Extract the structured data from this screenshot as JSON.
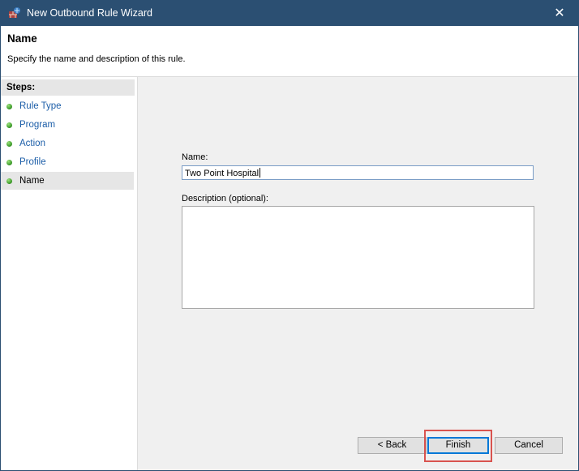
{
  "window": {
    "title": "New Outbound Rule Wizard",
    "close_glyph": "✕",
    "icon": "firewall-icon"
  },
  "header": {
    "title": "Name",
    "subtitle": "Specify the name and description of this rule."
  },
  "steps": {
    "heading": "Steps:",
    "items": [
      {
        "label": "Rule Type",
        "state": "completed"
      },
      {
        "label": "Program",
        "state": "completed"
      },
      {
        "label": "Action",
        "state": "completed"
      },
      {
        "label": "Profile",
        "state": "completed"
      },
      {
        "label": "Name",
        "state": "current"
      }
    ],
    "dot_color": "#3c9a2a",
    "link_color": "#1c5ea8"
  },
  "form": {
    "name_label": "Name:",
    "name_value": "Two Point Hospital",
    "description_label": "Description (optional):",
    "description_value": ""
  },
  "buttons": {
    "back": "< Back",
    "finish": "Finish",
    "cancel": "Cancel"
  },
  "colors": {
    "titlebar": "#2b4f72",
    "highlight": "#d9534f",
    "focus_border": "#0078d7"
  }
}
